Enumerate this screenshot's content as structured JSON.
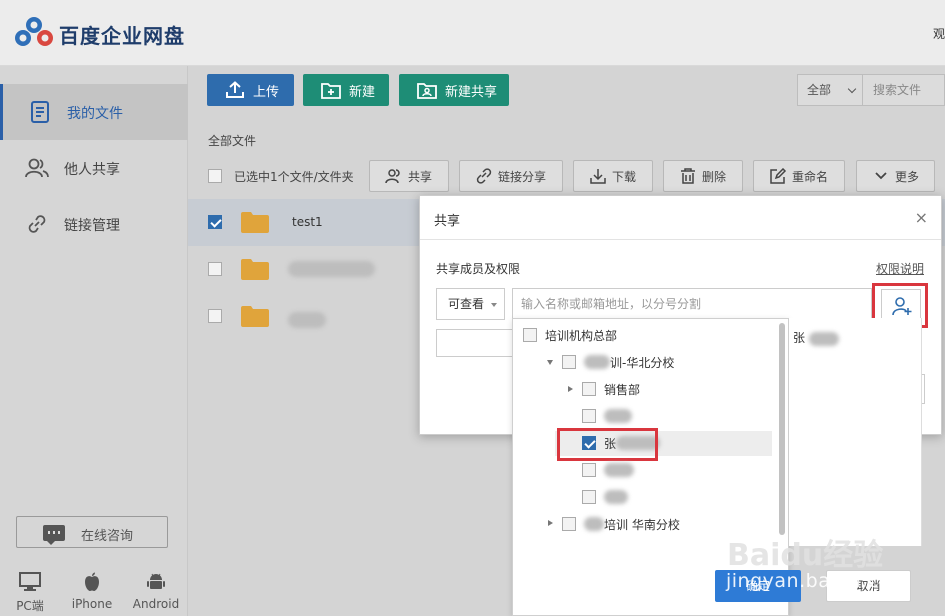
{
  "header": {
    "brand": "百度企业网盘",
    "right_text": "观"
  },
  "sidebar": {
    "items": [
      {
        "label": "我的文件",
        "active": true
      },
      {
        "label": "他人共享",
        "active": false
      },
      {
        "label": "链接管理",
        "active": false
      }
    ],
    "consult_label": "在线咨询",
    "platforms": [
      "PC端",
      "iPhone",
      "Android"
    ]
  },
  "toolbar": {
    "upload_label": "上传",
    "new_label": "新建",
    "new_share_label": "新建共享",
    "filter_value": "全部",
    "search_placeholder": "搜索文件"
  },
  "breadcrumb": "全部文件",
  "selection": {
    "info": "已选中1个文件/文件夹",
    "actions": [
      "共享",
      "链接分享",
      "下载",
      "删除",
      "重命名",
      "更多"
    ]
  },
  "files": [
    {
      "name": "test1",
      "checked": true
    },
    {
      "name": "",
      "checked": false
    },
    {
      "name": "",
      "checked": false
    }
  ],
  "share_dialog": {
    "title": "共享",
    "close_glyph": "×",
    "members_label": "共享成员及权限",
    "perm_help_link": "权限说明",
    "permission_value": "可查看",
    "input_placeholder": "输入名称或邮箱地址，以分号分割",
    "tree": [
      {
        "label": "培训机构总部",
        "checked": false
      },
      {
        "label": "训-华北分校",
        "checked": false
      },
      {
        "label": "销售部",
        "checked": false
      },
      {
        "label": "",
        "checked": false
      },
      {
        "label": "张",
        "checked": true
      },
      {
        "label": "",
        "checked": false
      },
      {
        "label": "",
        "checked": false
      },
      {
        "label": "培训 华南分校",
        "checked": false
      }
    ],
    "selected_member": "张",
    "confirm_label": "确定",
    "cancel_label": "取消"
  },
  "watermark": {
    "logo": "Baidu经验",
    "text": "jingyan.baidu.com"
  },
  "colors": {
    "primary_blue": "#2e6cad",
    "green": "#1e8d76",
    "highlight_red": "#d9363e",
    "folder_yellow": "#e0a43b"
  }
}
